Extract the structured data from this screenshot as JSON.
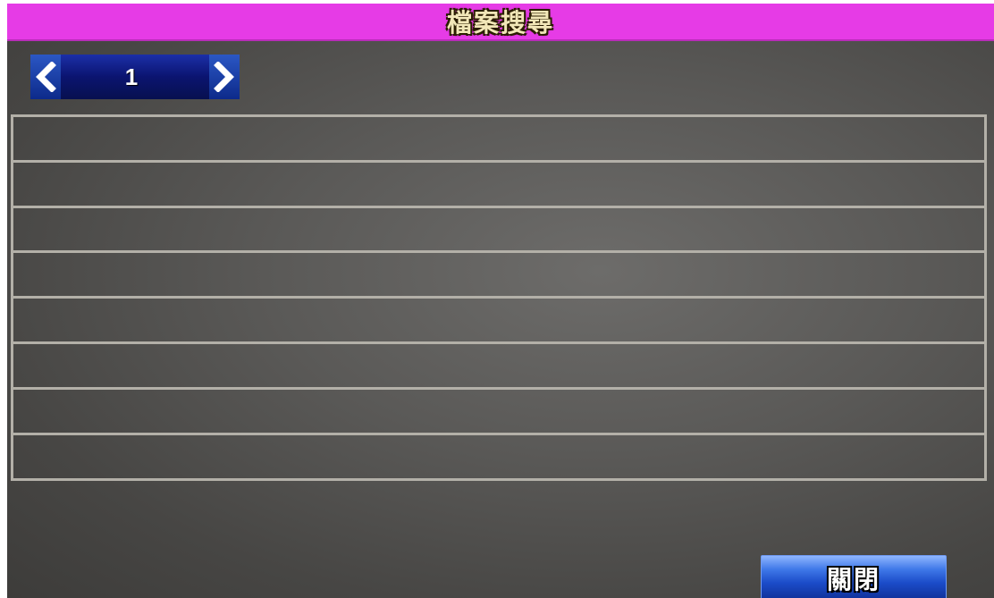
{
  "window": {
    "title": "檔案搜尋"
  },
  "pager": {
    "current_page": "1",
    "prev_icon": "chevron-left-icon",
    "next_icon": "chevron-right-icon"
  },
  "file_list": {
    "rows": [
      "",
      "",
      "",
      "",
      "",
      "",
      "",
      ""
    ]
  },
  "footer": {
    "close_label": "關閉"
  },
  "colors": {
    "title_bar": "#e63be6",
    "title_text": "#f2e7b8",
    "background": "#5a5957",
    "grid_lines": "#b3b0a8",
    "pager_bg": "#0b1470",
    "button_blue": "#1b4cc9"
  }
}
